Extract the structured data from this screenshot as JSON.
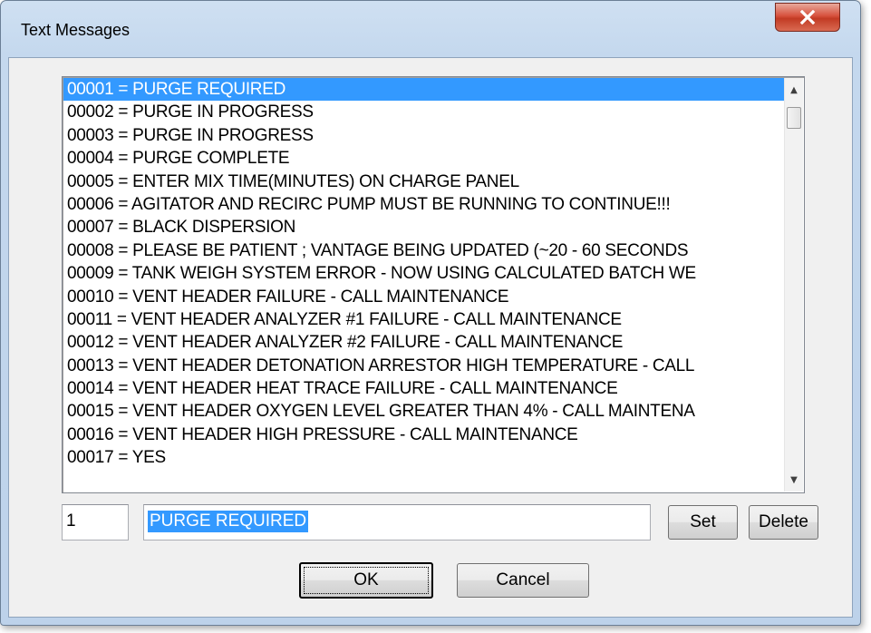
{
  "window": {
    "title": "Text Messages",
    "close_icon": "close-x-icon"
  },
  "messages": [
    "00001 = PURGE REQUIRED",
    "00002 = PURGE IN PROGRESS",
    "00003 = PURGE IN PROGRESS",
    "00004 = PURGE COMPLETE",
    "00005 = ENTER MIX TIME(MINUTES) ON CHARGE PANEL",
    "00006 = AGITATOR AND RECIRC PUMP MUST BE RUNNING TO CONTINUE!!!",
    "00007 = BLACK DISPERSION",
    "00008 = PLEASE BE PATIENT ; VANTAGE BEING UPDATED (~20 - 60 SECONDS",
    "00009 = TANK WEIGH SYSTEM ERROR - NOW USING CALCULATED BATCH WE",
    "00010 = VENT HEADER FAILURE - CALL MAINTENANCE",
    "00011 = VENT HEADER ANALYZER #1 FAILURE - CALL MAINTENANCE",
    "00012 = VENT HEADER ANALYZER #2 FAILURE - CALL MAINTENANCE",
    "00013 = VENT HEADER DETONATION ARRESTOR HIGH TEMPERATURE - CALL",
    "00014 = VENT HEADER HEAT TRACE FAILURE - CALL MAINTENANCE",
    "00015 = VENT HEADER OXYGEN LEVEL GREATER THAN 4% - CALL MAINTENA",
    "00016 = VENT HEADER HIGH PRESSURE - CALL MAINTENANCE",
    "00017 = YES"
  ],
  "selected_index": 0,
  "editor": {
    "number_value": "1",
    "text_value": "PURGE REQUIRED"
  },
  "buttons": {
    "set": "Set",
    "delete": "Delete",
    "ok": "OK",
    "cancel": "Cancel"
  },
  "colors": {
    "selection": "#3399ff",
    "close_button": "#c23b24"
  }
}
